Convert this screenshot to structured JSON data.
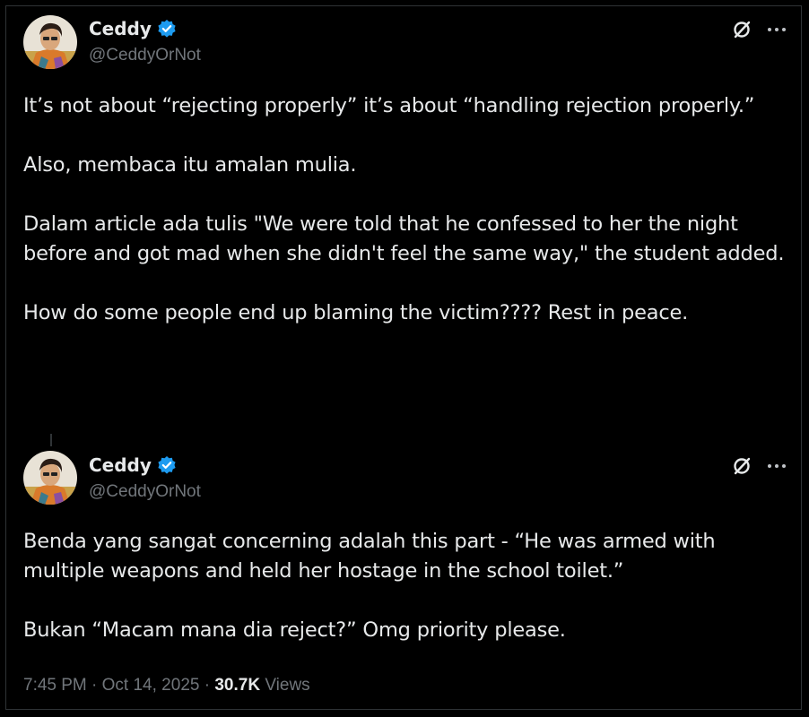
{
  "tweets": [
    {
      "author": {
        "name": "Ceddy",
        "handle": "@CeddyOrNot",
        "verified": true,
        "verified_color": "#1d9bf0"
      },
      "icons": [
        "grok-icon",
        "more-icon"
      ],
      "paragraphs": [
        "It’s not about “rejecting properly” it’s about “handling rejection properly.”",
        "Also, membaca itu amalan mulia.",
        "Dalam article ada tulis \"We were told that he confessed to her the night before and got mad when she didn't feel the same way,\" the student added.",
        "How do some people end up blaming the victim???? Rest in peace."
      ]
    },
    {
      "author": {
        "name": "Ceddy",
        "handle": "@CeddyOrNot",
        "verified": true,
        "verified_color": "#1d9bf0"
      },
      "icons": [
        "grok-icon",
        "more-icon"
      ],
      "paragraphs": [
        "Benda yang sangat concerning adalah this part - “He was armed with multiple weapons and held her hostage in the school toilet.”",
        "Bukan “Macam mana dia reject?” Omg priority please."
      ]
    }
  ],
  "meta": {
    "time": "7:45 PM",
    "separator": "·",
    "date": "Oct 14, 2025",
    "views_count": "30.7K",
    "views_label": "Views"
  },
  "colors": {
    "background": "#000000",
    "text": "#e7e9ea",
    "secondary": "#71767b",
    "verified": "#1d9bf0"
  }
}
